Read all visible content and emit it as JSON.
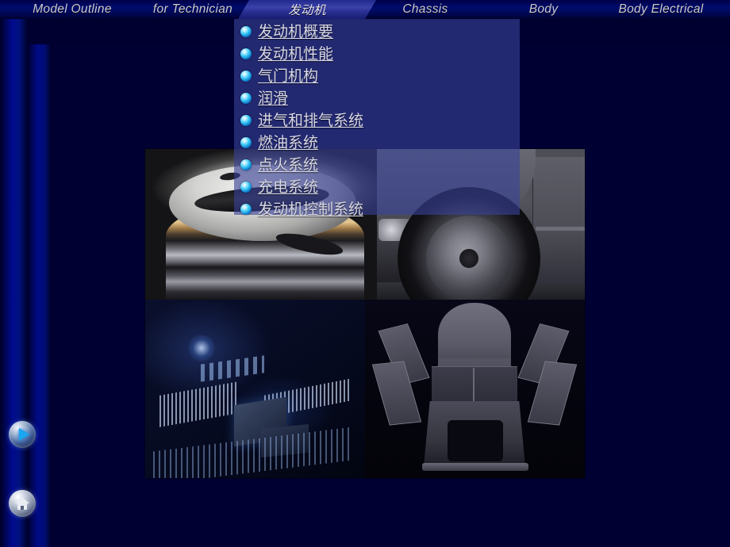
{
  "app": {
    "title": "Model Outline for Technician",
    "background_color": "#000038",
    "accent_color": "#384298"
  },
  "navbar": {
    "tabs": [
      {
        "label": "Model Outline",
        "active": false
      },
      {
        "label": "for Technician",
        "active": false
      },
      {
        "label": "发动机",
        "active": true
      },
      {
        "label": "Chassis",
        "active": false
      },
      {
        "label": "Body",
        "active": false
      },
      {
        "label": "Body Electrical",
        "active": false
      }
    ]
  },
  "menu": {
    "items": [
      {
        "label": "发动机概要",
        "bullet": "sphere-bullet-icon"
      },
      {
        "label": "发动机性能",
        "bullet": "sphere-bullet-icon"
      },
      {
        "label": "气门机构",
        "bullet": "sphere-bullet-icon"
      },
      {
        "label": "润滑",
        "bullet": "sphere-bullet-icon"
      },
      {
        "label": "进气和排气系统",
        "bullet": "sphere-bullet-icon"
      },
      {
        "label": "燃油系统",
        "bullet": "sphere-bullet-icon"
      },
      {
        "label": "点火系统",
        "bullet": "sphere-bullet-icon"
      },
      {
        "label": "充电系统",
        "bullet": "sphere-bullet-icon"
      },
      {
        "label": "发动机控制系统",
        "bullet": "sphere-bullet-icon"
      }
    ]
  },
  "collage": {
    "quadrants": [
      {
        "name": "engine-piston-photo",
        "position": "top-left"
      },
      {
        "name": "car-wheel-photo",
        "position": "top-right"
      },
      {
        "name": "circuit-board-photo",
        "position": "bottom-left"
      },
      {
        "name": "car-body-shell-photo",
        "position": "bottom-right"
      }
    ]
  },
  "controls": {
    "next_button": "next-slide-icon",
    "home_button": "home-icon"
  }
}
